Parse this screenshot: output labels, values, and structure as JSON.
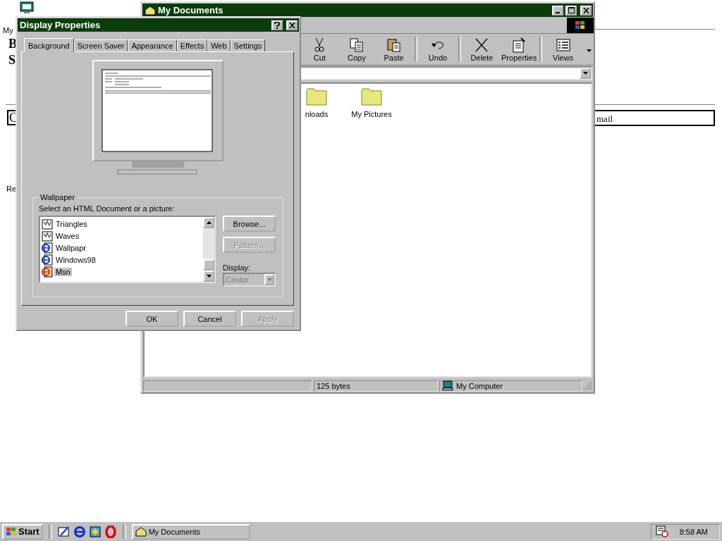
{
  "desktop": {
    "fragments_left": [
      "My",
      "B",
      "S",
      "C",
      "Re"
    ],
    "fragments_right": [
      "mail"
    ]
  },
  "explorer": {
    "title": "My Documents",
    "toolbar": [
      [
        {
          "kind": "cut",
          "label": "Cut"
        },
        {
          "kind": "copy",
          "label": "Copy"
        },
        {
          "kind": "paste",
          "label": "Paste"
        }
      ],
      [
        {
          "kind": "undo",
          "label": "Undo"
        }
      ],
      [
        {
          "kind": "delete",
          "label": "Delete"
        },
        {
          "kind": "properties",
          "label": "Properties"
        }
      ],
      [
        {
          "kind": "views",
          "label": "Views"
        }
      ]
    ],
    "folders": [
      {
        "label": "nloads"
      },
      {
        "label": "My Pictures"
      }
    ],
    "status": {
      "size": "125 bytes",
      "zone": "My Computer"
    }
  },
  "dialog": {
    "title": "Display Properties",
    "tabs": [
      {
        "label": "Background",
        "selected": true
      },
      {
        "label": "Screen Saver",
        "selected": false
      },
      {
        "label": "Appearance",
        "selected": false
      },
      {
        "label": "Effects",
        "selected": false
      },
      {
        "label": "Web",
        "selected": false
      },
      {
        "label": "Settings",
        "selected": false
      }
    ],
    "group_label": "Wallpaper",
    "prompt": "Select an HTML Document or a picture:",
    "wallpapers": [
      {
        "kind": "picture",
        "label": "Triangles",
        "selected": false
      },
      {
        "kind": "picture",
        "label": "Waves",
        "selected": false
      },
      {
        "kind": "html",
        "label": "Wallpapr",
        "selected": false
      },
      {
        "kind": "html",
        "label": "Windows98",
        "selected": false
      },
      {
        "kind": "msn",
        "label": "Msn",
        "selected": true
      }
    ],
    "browse": {
      "label": "Browse..."
    },
    "pattern": {
      "label": "Pattern...",
      "disabled": true
    },
    "display_label": "Display:",
    "display": {
      "value": "Center",
      "disabled": true
    },
    "buttons": [
      {
        "label": "OK",
        "disabled": false
      },
      {
        "label": "Cancel",
        "disabled": false
      },
      {
        "label": "Apply",
        "disabled": true
      }
    ]
  },
  "taskbar": {
    "start": "Start",
    "quick_launch": [
      {
        "kind": "desktop"
      },
      {
        "kind": "browser"
      },
      {
        "kind": "channels"
      },
      {
        "kind": "red-o"
      }
    ],
    "tasks": [
      {
        "label": "My Documents",
        "selected": false
      }
    ],
    "clock": "8:58 AM"
  }
}
